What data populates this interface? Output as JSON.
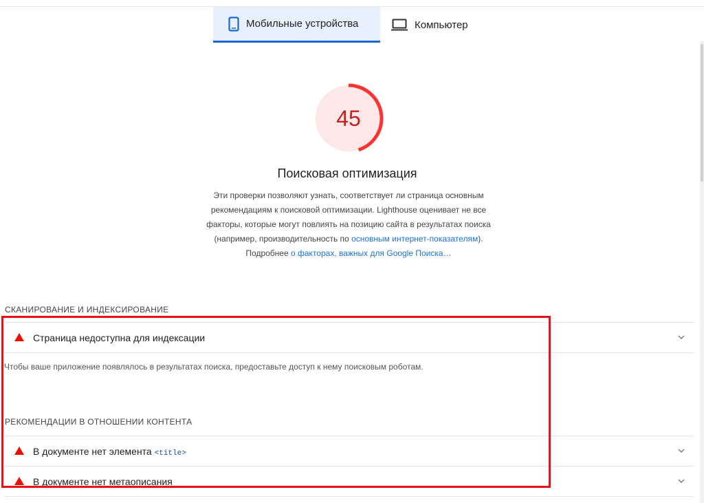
{
  "tabs": [
    {
      "label": "Мобильные устройства",
      "icon": "smartphone-icon",
      "active": true
    },
    {
      "label": "Компьютер",
      "icon": "laptop-icon",
      "active": false
    }
  ],
  "score": {
    "value": "45",
    "fraction": 0.45,
    "color": "#ff3333",
    "bg": "#fce8e6"
  },
  "category": {
    "title": "Поисковая оптимизация",
    "desc_part1": "Эти проверки позволяют узнать, соответствует ли страница основным рекомендациям к поисковой оптимизации. Lighthouse оценивает не все факторы, которые могут повлиять на позицию сайта в результатах поиска (например, производительность по ",
    "desc_link1": "основным интернет-показателям",
    "desc_part2": "). Подробнее ",
    "desc_link2": "о факторах, важных для Google Поиска…"
  },
  "groups": [
    {
      "header": "СКАНИРОВАНИЕ И ИНДЕКСИРОВАНИЕ",
      "audits": [
        {
          "title": "Страница недоступна для индексации",
          "status": "fail"
        }
      ],
      "description": "Чтобы ваше приложение появлялось в результатах поиска, предоставьте доступ к нему поисковым роботам."
    },
    {
      "header": "РЕКОМЕНДАЦИИ В ОТНОШЕНИИ КОНТЕНТА",
      "audits": [
        {
          "title_prefix": "В документе нет элемента ",
          "title_code": "<title>",
          "status": "fail"
        },
        {
          "title": "В документе нет метаописания",
          "status": "fail"
        }
      ]
    }
  ],
  "colors": {
    "fail": "#eb0f00",
    "link": "#1a73e8",
    "highlight": "#e8111a"
  }
}
